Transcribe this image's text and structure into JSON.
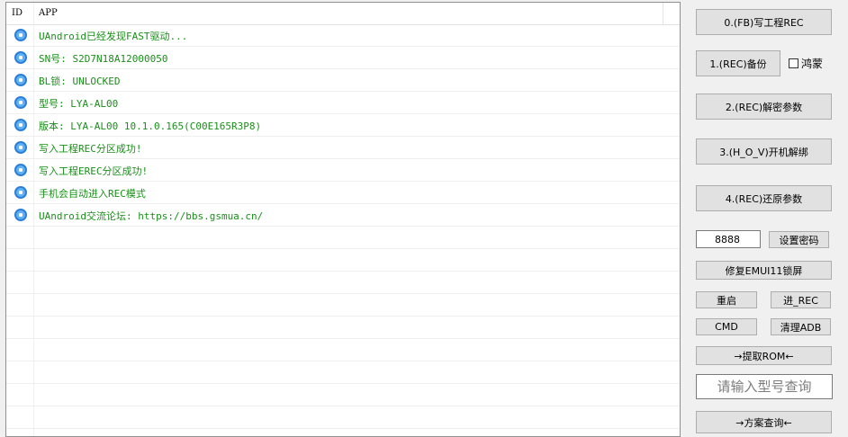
{
  "log": {
    "header": {
      "id": "ID",
      "app": "APP"
    },
    "rows": [
      "UAndroid已经发现FAST驱动...",
      "SN号: S2D7N18A12000050",
      "BL锁: UNLOCKED",
      "型号: LYA-AL00",
      "版本: LYA-AL00 10.1.0.165(C00E165R3P8)",
      "写入工程REC分区成功!",
      "写入工程EREC分区成功!",
      "手机会自动进入REC模式",
      "UAndroid交流论坛: https://bbs.gsmua.cn/"
    ],
    "text_color": "#1a8f1a",
    "icon": "status-dot-icon"
  },
  "buttons": {
    "fb_write": "0.(FB)写工程REC",
    "rec_backup": "1.(REC)备份",
    "rec_decrypt": "2.(REC)解密参数",
    "hov_unbind": "3.(H_O_V)开机解绑",
    "rec_restore": "4.(REC)还原参数",
    "set_password": "设置密码",
    "fix_emui": "修复EMUI11锁屏",
    "reboot": "重启",
    "enter_rec": "进_REC",
    "cmd": "CMD",
    "clear_adb": "清理ADB",
    "extract_rom": "→提取ROM←",
    "scheme_query": "→方案查询←"
  },
  "hongmeng": {
    "label": "鸿蒙",
    "checked": false
  },
  "password": {
    "value": "8888"
  },
  "model_query": {
    "placeholder": "请输入型号查询"
  }
}
